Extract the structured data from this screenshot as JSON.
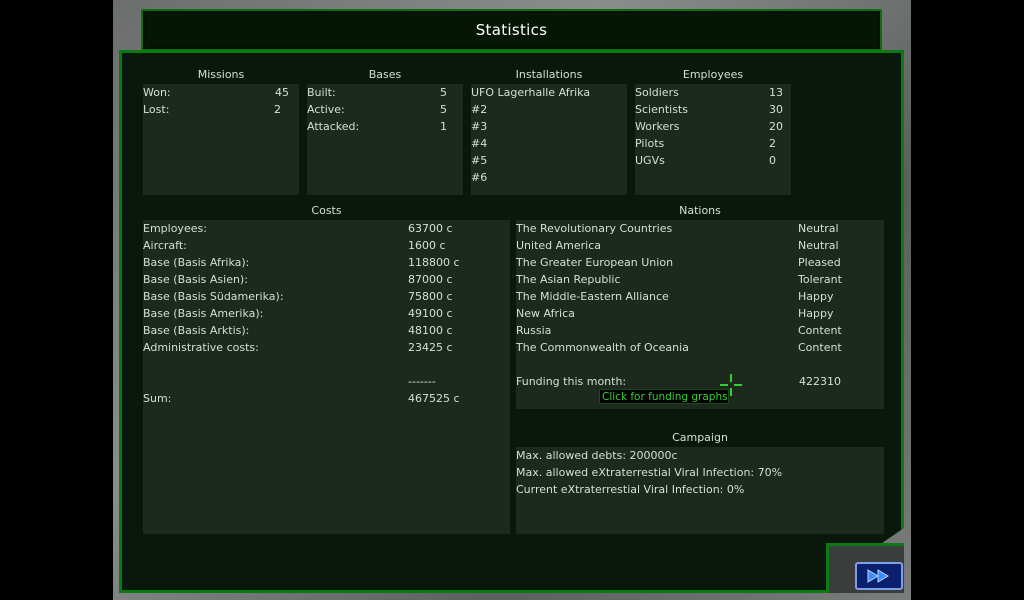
{
  "title": "Statistics",
  "missions": {
    "title": "Missions",
    "rows": [
      {
        "label": "Won:",
        "value": "45"
      },
      {
        "label": "Lost:",
        "value": "2"
      }
    ]
  },
  "bases": {
    "title": "Bases",
    "rows": [
      {
        "label": "Built:",
        "value": "5"
      },
      {
        "label": "Active:",
        "value": "5"
      },
      {
        "label": "Attacked:",
        "value": "1"
      }
    ]
  },
  "installations": {
    "title": "Installations",
    "items": [
      "UFO Lagerhalle Afrika",
      "#2",
      "#3",
      "#4",
      "#5",
      "#6"
    ]
  },
  "employees": {
    "title": "Employees",
    "rows": [
      {
        "label": "Soldiers",
        "value": "13"
      },
      {
        "label": "Scientists",
        "value": "30"
      },
      {
        "label": "Workers",
        "value": "20"
      },
      {
        "label": "Pilots",
        "value": "2"
      },
      {
        "label": "UGVs",
        "value": "0"
      }
    ]
  },
  "costs": {
    "title": "Costs",
    "rows": [
      {
        "label": "Employees:",
        "value": "63700 c"
      },
      {
        "label": "Aircraft:",
        "value": "1600 c"
      },
      {
        "label": "Base (Basis Afrika):",
        "value": "118800 c"
      },
      {
        "label": "Base (Basis Asien):",
        "value": "87000 c"
      },
      {
        "label": "Base (Basis Südamerika):",
        "value": "75800 c"
      },
      {
        "label": "Base (Basis Amerika):",
        "value": "49100 c"
      },
      {
        "label": "Base (Basis Arktis):",
        "value": "48100 c"
      },
      {
        "label": "Administrative costs:",
        "value": "23425 c"
      }
    ],
    "separator": "-------",
    "sum_label": "Sum:",
    "sum_value": "467525 c"
  },
  "nations": {
    "title": "Nations",
    "rows": [
      {
        "name": "The Revolutionary Countries",
        "mood": "Neutral"
      },
      {
        "name": "United America",
        "mood": "Neutral"
      },
      {
        "name": "The Greater European Union",
        "mood": "Pleased"
      },
      {
        "name": "The Asian Republic",
        "mood": "Tolerant"
      },
      {
        "name": "The Middle-Eastern Alliance",
        "mood": "Happy"
      },
      {
        "name": "New Africa",
        "mood": "Happy"
      },
      {
        "name": "Russia",
        "mood": "Content"
      },
      {
        "name": "The Commonwealth of Oceania",
        "mood": "Content"
      }
    ],
    "funding_label": "Funding this month:",
    "funding_value": "422310",
    "funding_tooltip": "Click for funding graphs"
  },
  "campaign": {
    "title": "Campaign",
    "lines": [
      "Max. allowed debts: 200000c",
      "Max. allowed eXtraterrestial Viral Infection: 70%",
      "Current eXtraterrestial Viral Infection: 0%"
    ]
  },
  "icons": {
    "next": "fast-forward-icon",
    "cursor": "crosshair-icon"
  },
  "colors": {
    "panel_border": "#0c7a12",
    "panel_bg": "#0a180b",
    "box_bg": "#1b2a1c",
    "tooltip_text": "#2fd22f",
    "next_button_bg": "#0a1f6e"
  }
}
